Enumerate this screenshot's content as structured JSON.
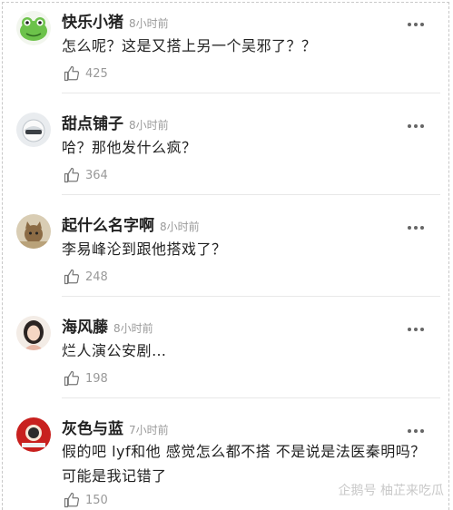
{
  "comments": [
    {
      "name": "快乐小猪",
      "time": "8小时前",
      "text": "怎么呢？这是又搭上另一个吴邪了？？",
      "likes": "425",
      "avatar": "frog"
    },
    {
      "name": "甜点铺子",
      "time": "8小时前",
      "text": "哈？那他发什么疯？",
      "likes": "364",
      "avatar": "helmet"
    },
    {
      "name": "起什么名字啊",
      "time": "8小时前",
      "text": "李易峰沦到跟他搭戏了？",
      "likes": "248",
      "avatar": "cat"
    },
    {
      "name": "海风藤",
      "time": "8小时前",
      "text": "烂人演公安剧…",
      "likes": "198",
      "avatar": "girl"
    },
    {
      "name": "灰色与蓝",
      "time": "7小时前",
      "text": "假的吧 lyf和他 感觉怎么都不搭 不是说是法医秦明吗？可能是我记错了",
      "likes": "150",
      "avatar": "red"
    }
  ],
  "watermark": "企鹅号 柚芷来吃瓜"
}
